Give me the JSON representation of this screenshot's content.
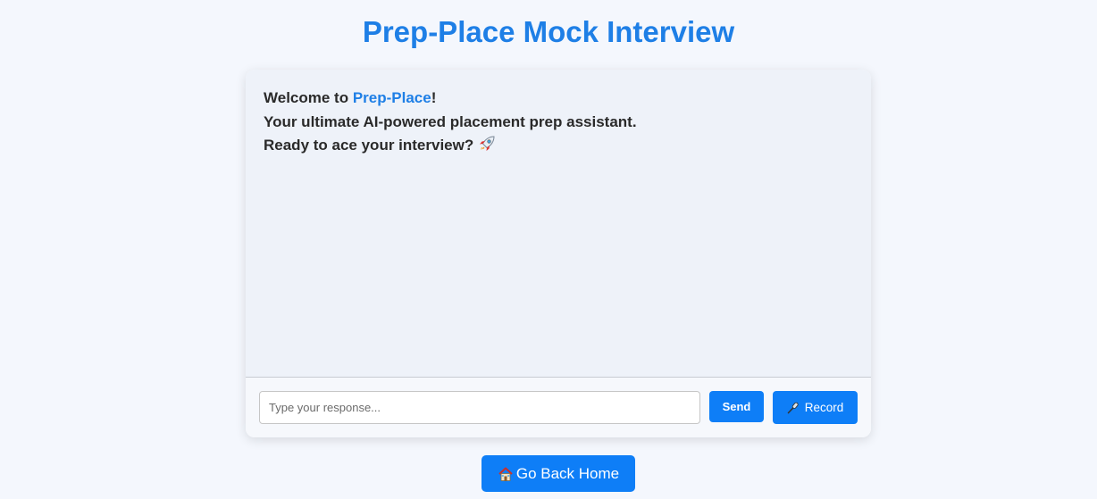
{
  "page": {
    "title": "Prep-Place Mock Interview"
  },
  "chat": {
    "welcome_prefix": "Welcome to ",
    "brand": "Prep-Place",
    "welcome_suffix": "!",
    "line2": "Your ultimate AI-powered placement prep assistant.",
    "line3": "Ready to ace your interview?",
    "line3_icon": "rocket-icon"
  },
  "input": {
    "placeholder": "Type your response...",
    "value": ""
  },
  "buttons": {
    "send_label": "Send",
    "record_label": "Record",
    "record_icon": "microphone-icon",
    "home_label": "Go Back Home",
    "home_icon": "house-icon"
  },
  "colors": {
    "accent": "#1e7fe6",
    "button": "#0e7ef7",
    "background": "#f4f7fd",
    "chat_background": "#eef2f9"
  }
}
